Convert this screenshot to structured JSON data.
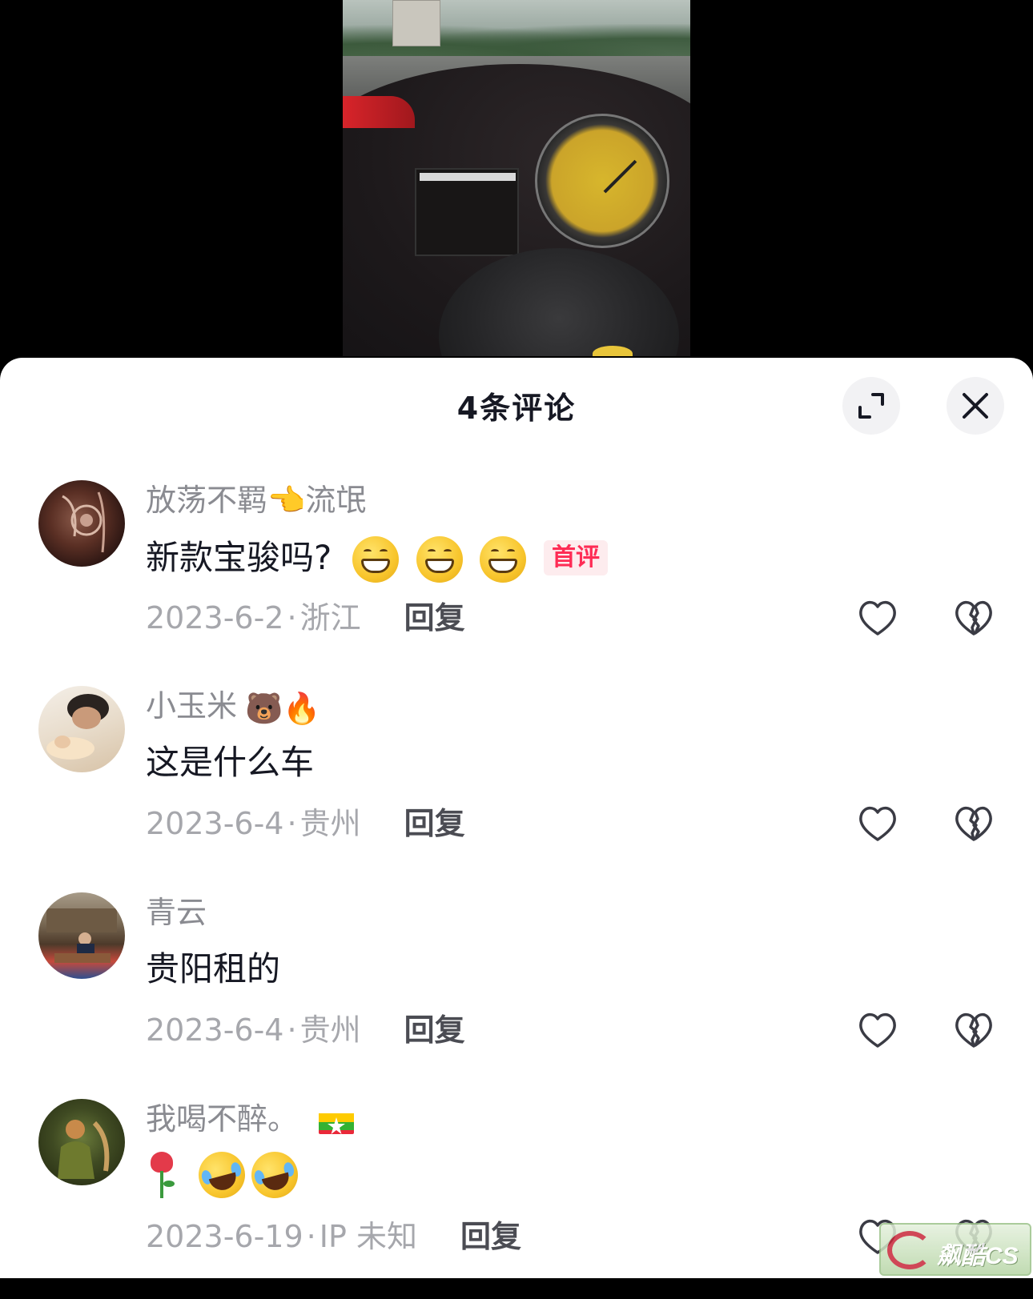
{
  "video": {},
  "sheet": {
    "title": "4条评论",
    "expand_icon": "expand-icon",
    "close_icon": "close-icon"
  },
  "comments": [
    {
      "username": "放荡不羁👈流氓",
      "text": "新款宝骏吗?",
      "emoji": "grin x3",
      "badge": "首评",
      "date": "2023-6-2",
      "sep": "·",
      "location": "浙江",
      "reply": "回复"
    },
    {
      "username": "小玉米",
      "username_emojis": "🐻🔥",
      "text": "这是什么车",
      "date": "2023-6-4",
      "sep": "·",
      "location": "贵州",
      "reply": "回复"
    },
    {
      "username": "青云",
      "text": "贵阳租的",
      "date": "2023-6-4",
      "sep": "·",
      "location": "贵州",
      "reply": "回复"
    },
    {
      "username": "我喝不醉。",
      "username_flag": "🇲🇲",
      "text_emojis": "rose, laugh-cry x2",
      "date": "2023-6-19",
      "sep": "·",
      "location": "IP 未知",
      "reply": "回复"
    }
  ],
  "colors": {
    "accent": "#fe2c55",
    "username": "#8a8b91",
    "text": "#161823",
    "meta": "#a6a7ac"
  }
}
